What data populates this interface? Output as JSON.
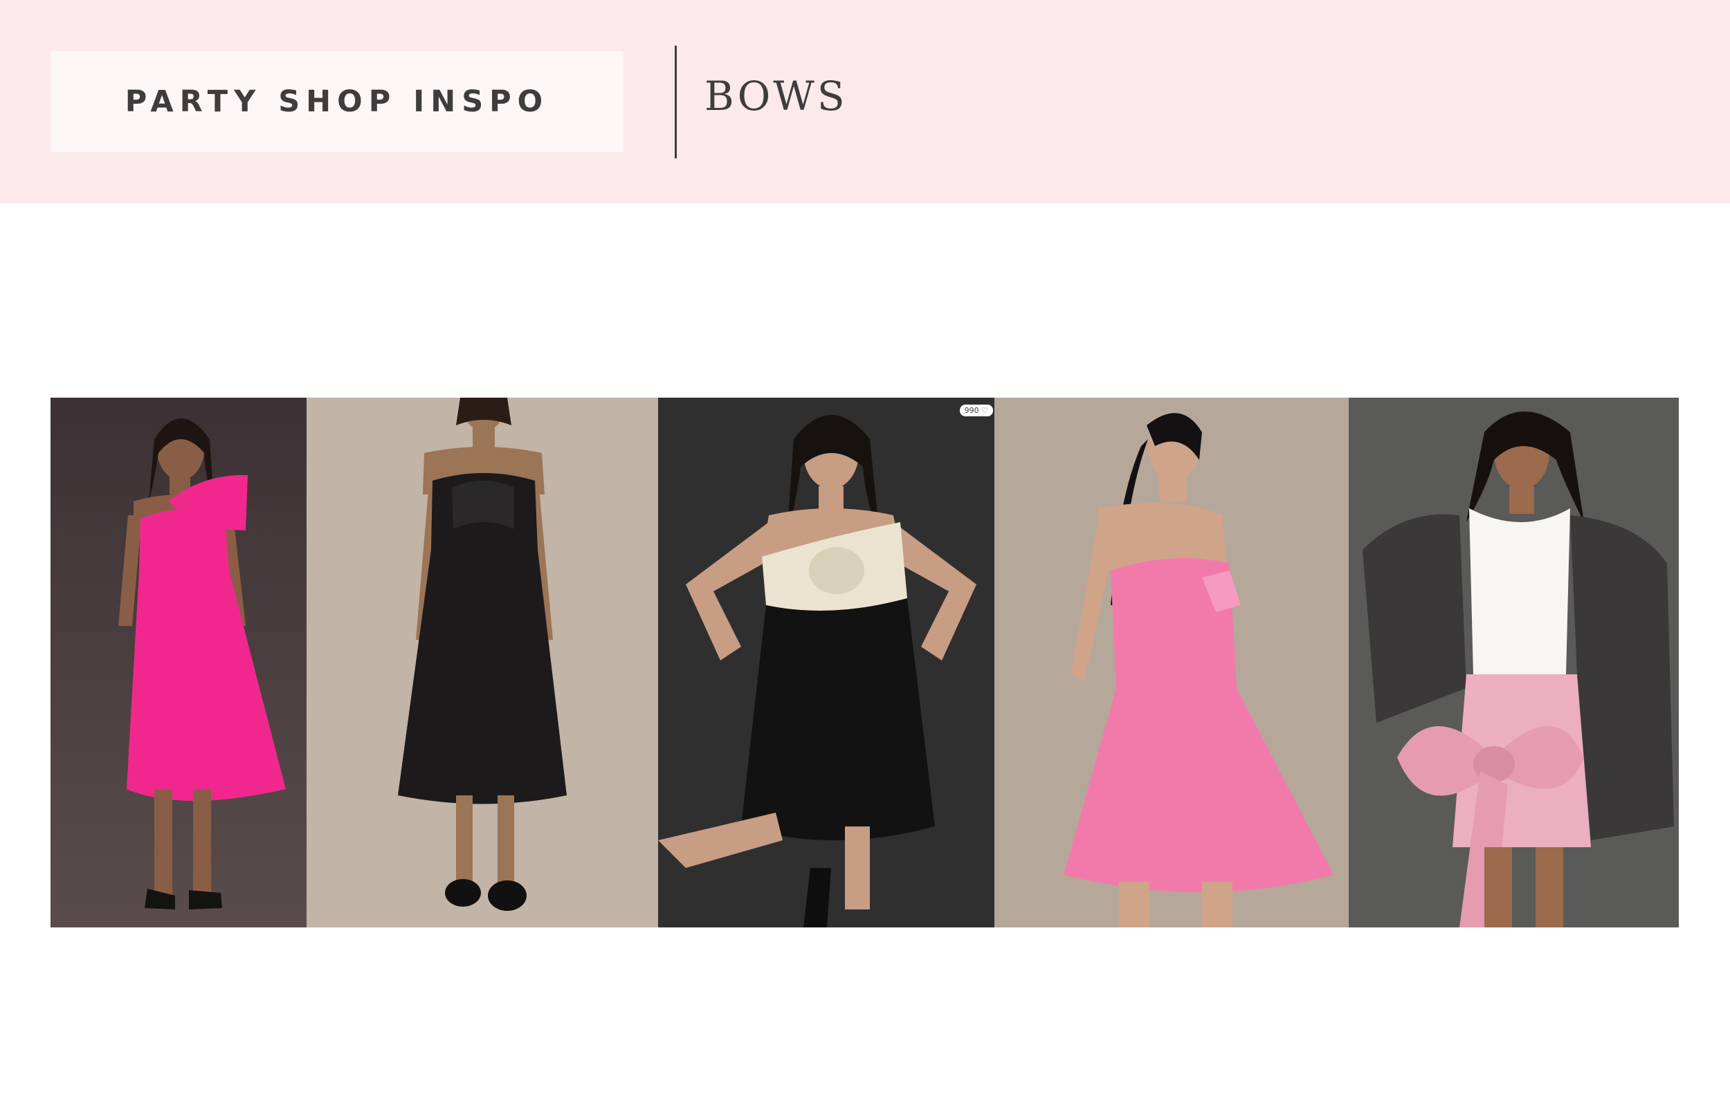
{
  "header": {
    "label": "PARTY SHOP INSPO",
    "title": "BOWS",
    "background_color": "#fce9ea"
  },
  "gallery": {
    "photos": [
      {
        "subject": "model-in-hot-pink-bow-midi-dress",
        "dress_color": "#f0288e",
        "backdrop_color": "#463c3e"
      },
      {
        "subject": "model-in-black-bow-midi-dress",
        "dress_color": "#1c1a1b",
        "backdrop_color": "#c2b4a6"
      },
      {
        "subject": "model-in-black-and-cream-bow-mini-dress",
        "dress_color": "#121212",
        "bow_color": "#eae3cf",
        "backdrop_color": "#2f2f2f",
        "badge": "990 ♡"
      },
      {
        "subject": "model-in-pink-strapless-bow-mini-dress",
        "dress_color": "#f27aaa",
        "backdrop_color": "#b6a79b"
      },
      {
        "subject": "model-in-tank-and-pink-bow-skirt",
        "dress_color": "#ecaec1",
        "backdrop_color": "#5a5a58"
      }
    ]
  }
}
